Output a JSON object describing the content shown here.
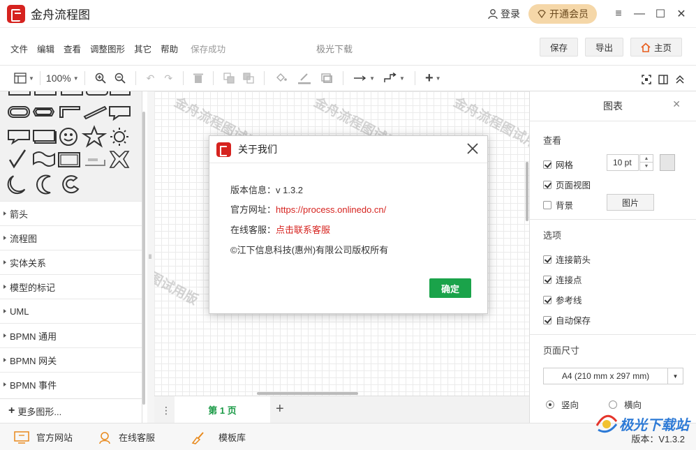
{
  "app": {
    "title": "金舟流程图",
    "login": "登录",
    "vip": "开通会员"
  },
  "menu": {
    "items": [
      "文件",
      "编辑",
      "查看",
      "调整图形",
      "其它",
      "帮助"
    ],
    "status": "保存成功",
    "watermark": "极光下载",
    "save": "保存",
    "export": "导出",
    "home": "主页"
  },
  "toolbar": {
    "zoom": "100%"
  },
  "shape_categories": [
    "箭头",
    "流程图",
    "实体关系",
    "模型的标记",
    "UML",
    "BPMN 通用",
    "BPMN 网关",
    "BPMN 事件"
  ],
  "more_shapes": "更多图形...",
  "canvas": {
    "watermark": "金舟流程图试用版",
    "watermark_short": "图试用版"
  },
  "pages": {
    "tab": "第 1 页"
  },
  "right_panel": {
    "title": "图表",
    "view_title": "查看",
    "grid": "网格",
    "grid_size": "10 pt",
    "page_view": "页面视图",
    "background": "背景",
    "image_button": "图片",
    "options_title": "选项",
    "connect_arrows": "连接箭头",
    "connect_points": "连接点",
    "guides": "参考线",
    "autosave": "自动保存",
    "page_size_title": "页面尺寸",
    "page_size": "A4 (210 mm x 297 mm)",
    "portrait": "竖向",
    "landscape": "横向"
  },
  "status": {
    "site": "官方网站",
    "support": "在线客服",
    "templates": "模板库",
    "version": "版本：V1.3.2"
  },
  "brand_watermark": "极光下载站",
  "dialog": {
    "title": "关于我们",
    "version_label": "版本信息：",
    "version_value": "v 1.3.2",
    "site_label": "官方网址：",
    "site_value": "https://process.onlinedo.cn/",
    "support_label": "在线客服：",
    "support_value": "点击联系客服",
    "copyright": "©江下信息科技(惠州)有限公司版权所有",
    "ok": "确定"
  }
}
